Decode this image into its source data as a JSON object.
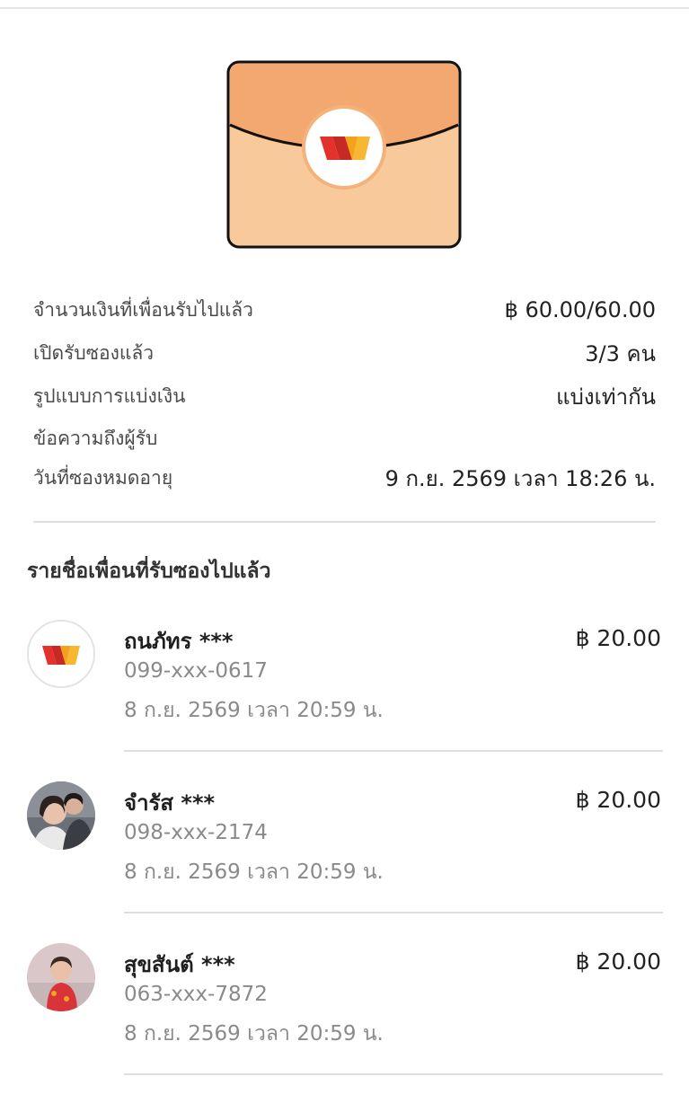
{
  "summary": {
    "rows": [
      {
        "label": "จำนวนเงินที่เพื่อนรับไปแล้ว",
        "value": "฿ 60.00/60.00"
      },
      {
        "label": "เปิดรับซองแล้ว",
        "value": "3/3 คน"
      },
      {
        "label": "รูปแบบการแบ่งเงิน",
        "value": "แบ่งเท่ากัน"
      },
      {
        "label": "ข้อความถึงผู้รับ",
        "value": ""
      },
      {
        "label": "วันที่ซองหมดอายุ",
        "value": "9 ก.ย. 2569 เวลา 18:26 น."
      }
    ]
  },
  "recipients_title": "รายชื่อเพื่อนที่รับซองไปแล้ว",
  "recipients": [
    {
      "name": "ถนภัทร ***",
      "phone": "099-xxx-0617",
      "date": "8 ก.ย. 2569 เวลา 20:59 น.",
      "amount": "฿ 20.00",
      "avatar": "brand-logo"
    },
    {
      "name": "จำรัส ***",
      "phone": "098-xxx-2174",
      "date": "8 ก.ย. 2569 เวลา 20:59 น.",
      "amount": "฿ 20.00",
      "avatar": "photo-couple"
    },
    {
      "name": "สุขสันต์ ***",
      "phone": "063-xxx-7872",
      "date": "8 ก.ย. 2569 เวลา 20:59 น.",
      "amount": "฿ 20.00",
      "avatar": "photo-child"
    }
  ],
  "colors": {
    "envelope_fill": "#f8c99a",
    "envelope_flap": "#f0a86a",
    "brand_red": "#e2322b",
    "brand_yellow": "#f2a31b"
  }
}
